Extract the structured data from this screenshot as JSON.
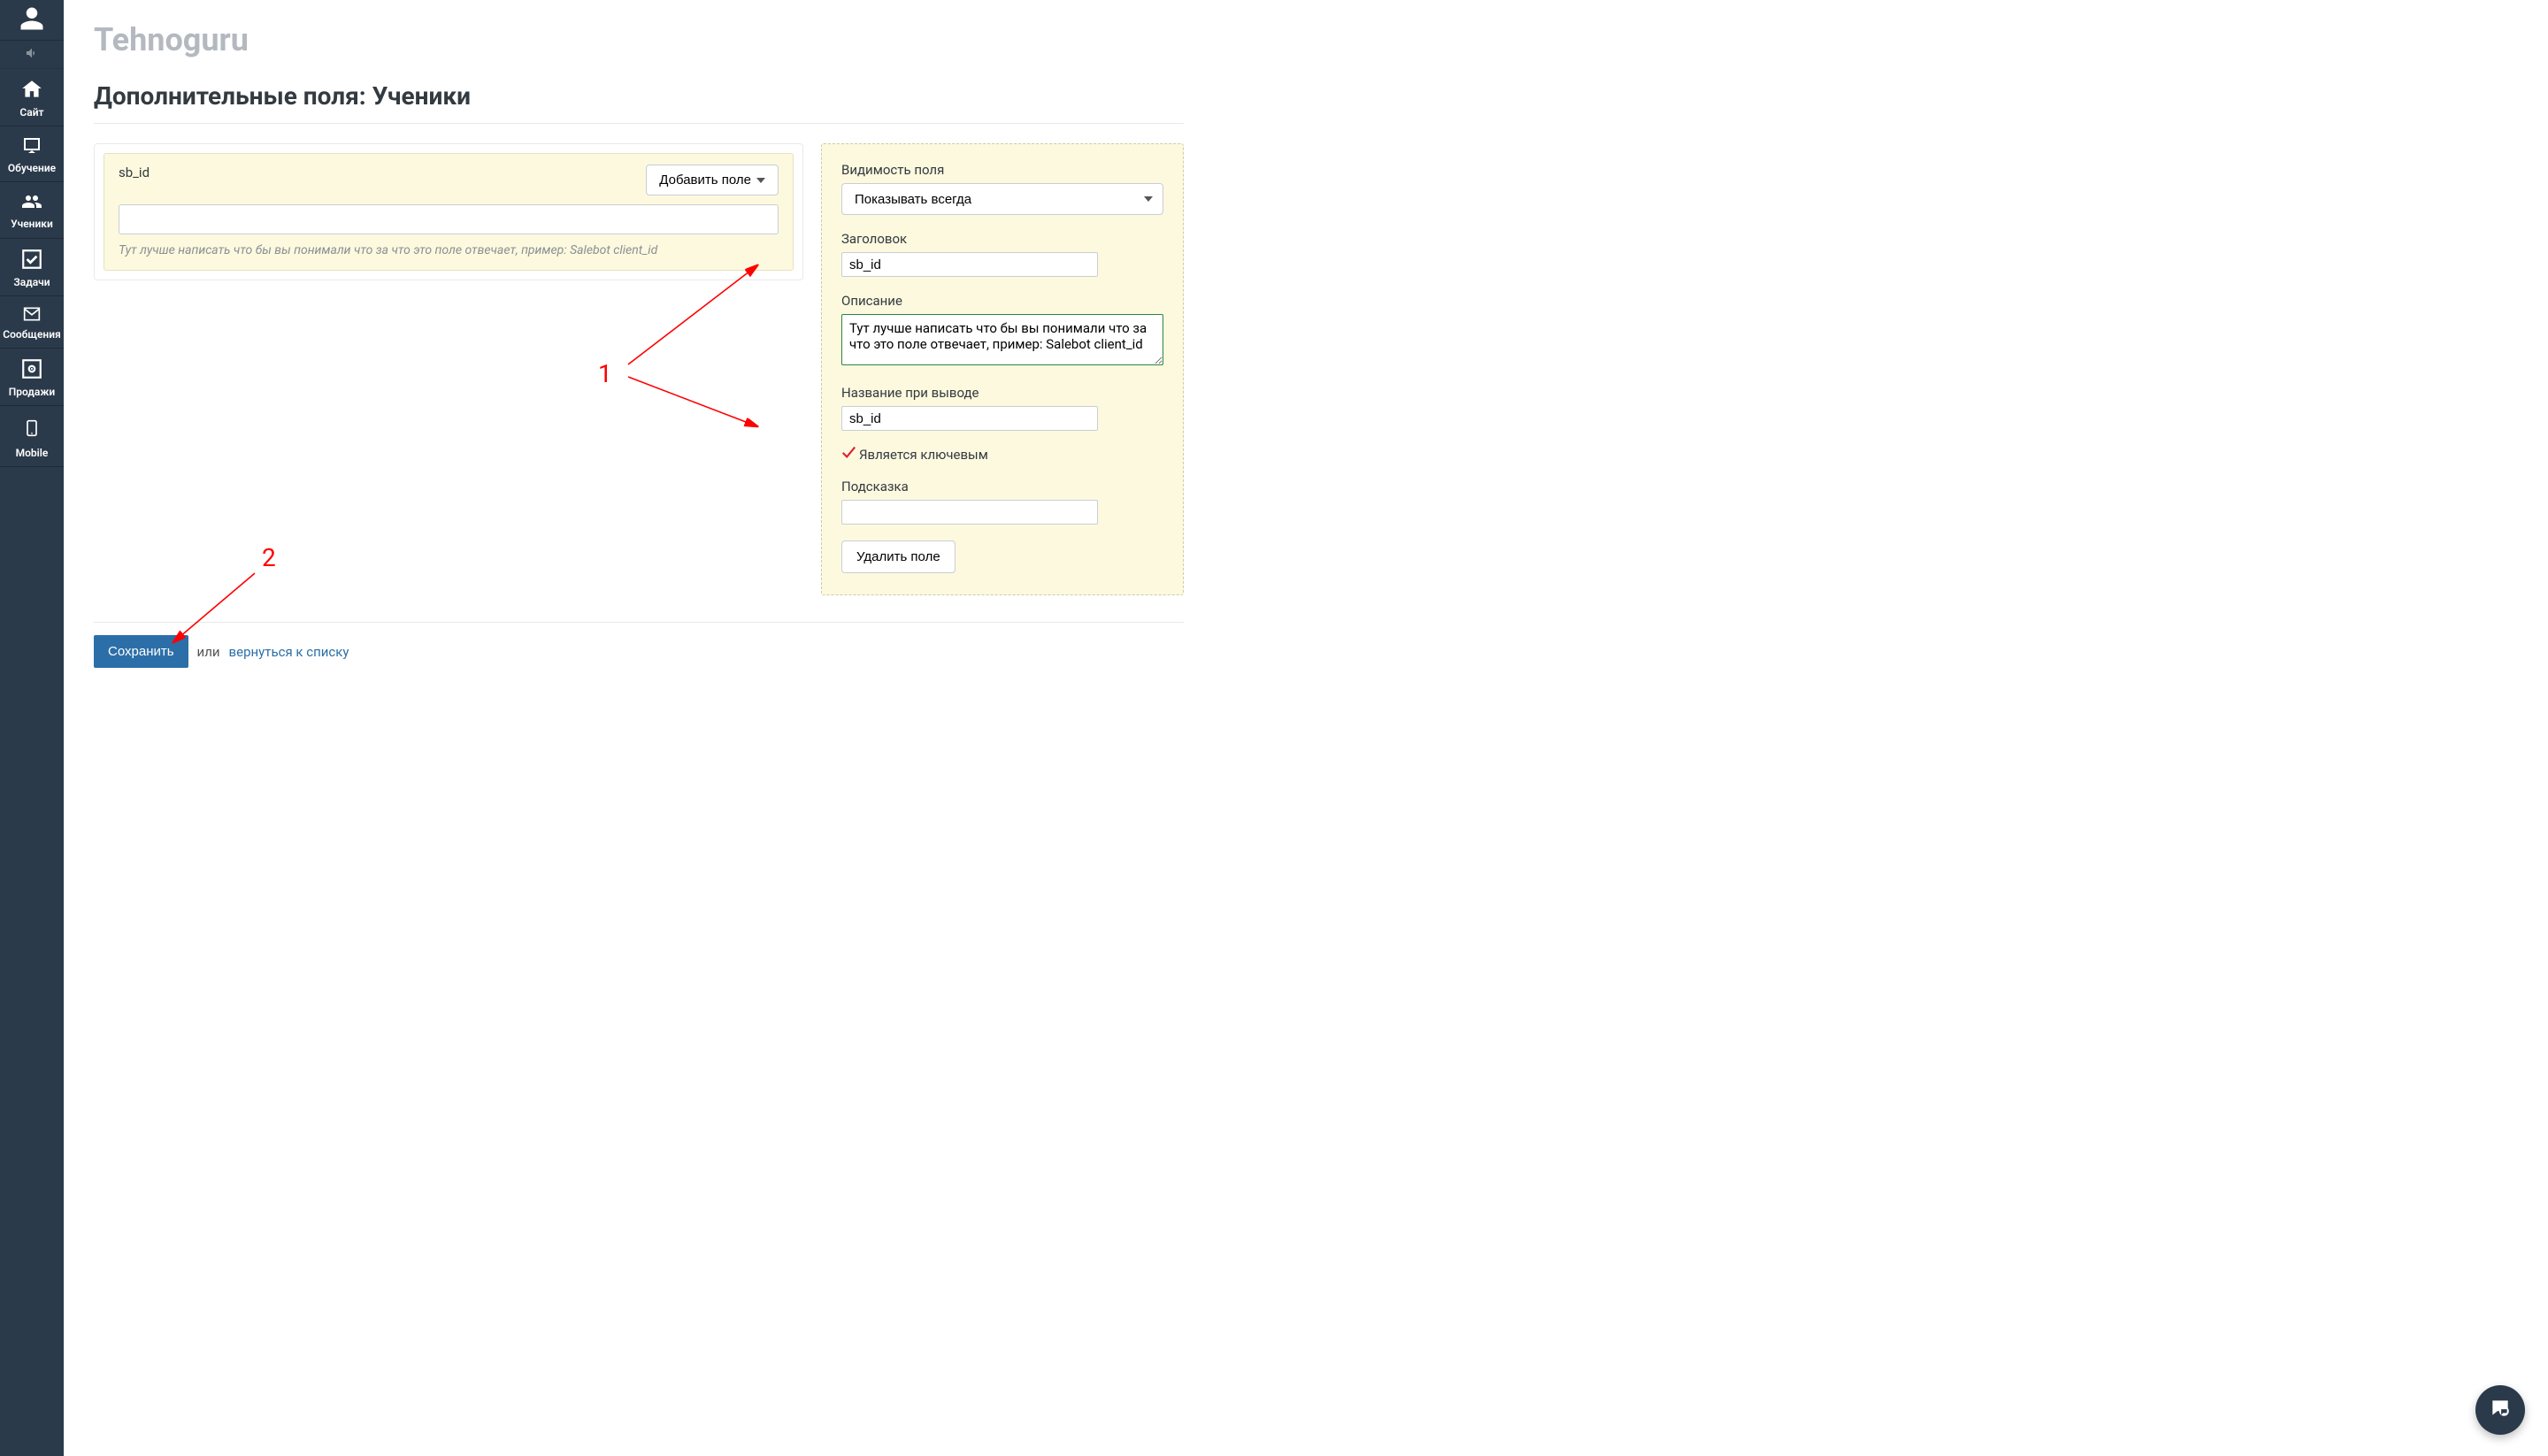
{
  "brand": "Tehnoguru",
  "page_title": "Дополнительные поля: Ученики",
  "sidebar": {
    "items": [
      {
        "key": "profile",
        "label": "",
        "icon": "user-icon"
      },
      {
        "key": "sound",
        "label": "",
        "icon": "sound-icon"
      },
      {
        "key": "site",
        "label": "Сайт",
        "icon": "home-icon"
      },
      {
        "key": "training",
        "label": "Обучение",
        "icon": "board-icon"
      },
      {
        "key": "students",
        "label": "Ученики",
        "icon": "users-icon"
      },
      {
        "key": "tasks",
        "label": "Задачи",
        "icon": "check-icon"
      },
      {
        "key": "messages",
        "label": "Сообщения",
        "icon": "mail-icon"
      },
      {
        "key": "sales",
        "label": "Продажи",
        "icon": "safe-icon"
      },
      {
        "key": "mobile",
        "label": "Mobile",
        "icon": "mobile-icon"
      }
    ]
  },
  "left_panel": {
    "field_name": "sb_id",
    "add_field_label": "Добавить поле",
    "input_value": "",
    "hint": "Тут лучше написать что бы вы понимали что за что это поле отвечает, пример: Salebot client_id"
  },
  "right_panel": {
    "visibility_label": "Видимость поля",
    "visibility_value": "Показывать всегда",
    "title_label": "Заголовок",
    "title_value": "sb_id",
    "description_label": "Описание",
    "description_value": "Тут лучше написать что бы вы понимали что за что это поле отвечает, пример: Salebot client_id",
    "output_name_label": "Название при выводе",
    "output_name_value": "sb_id",
    "is_key_label": "Является ключевым",
    "is_key_checked": true,
    "hint_label": "Подсказка",
    "hint_value": "",
    "delete_label": "Удалить поле"
  },
  "footer": {
    "save_label": "Сохранить",
    "or_text": "или",
    "back_link_label": "вернуться к списку"
  },
  "annotations": {
    "one": "1",
    "two": "2"
  },
  "colors": {
    "sidebar_bg": "#2b3a4a",
    "panel_yellow": "#fdf9df",
    "button_bg": "#2c6fa8",
    "annotation": "#ff0000",
    "textarea_active_border": "#2e8540"
  }
}
